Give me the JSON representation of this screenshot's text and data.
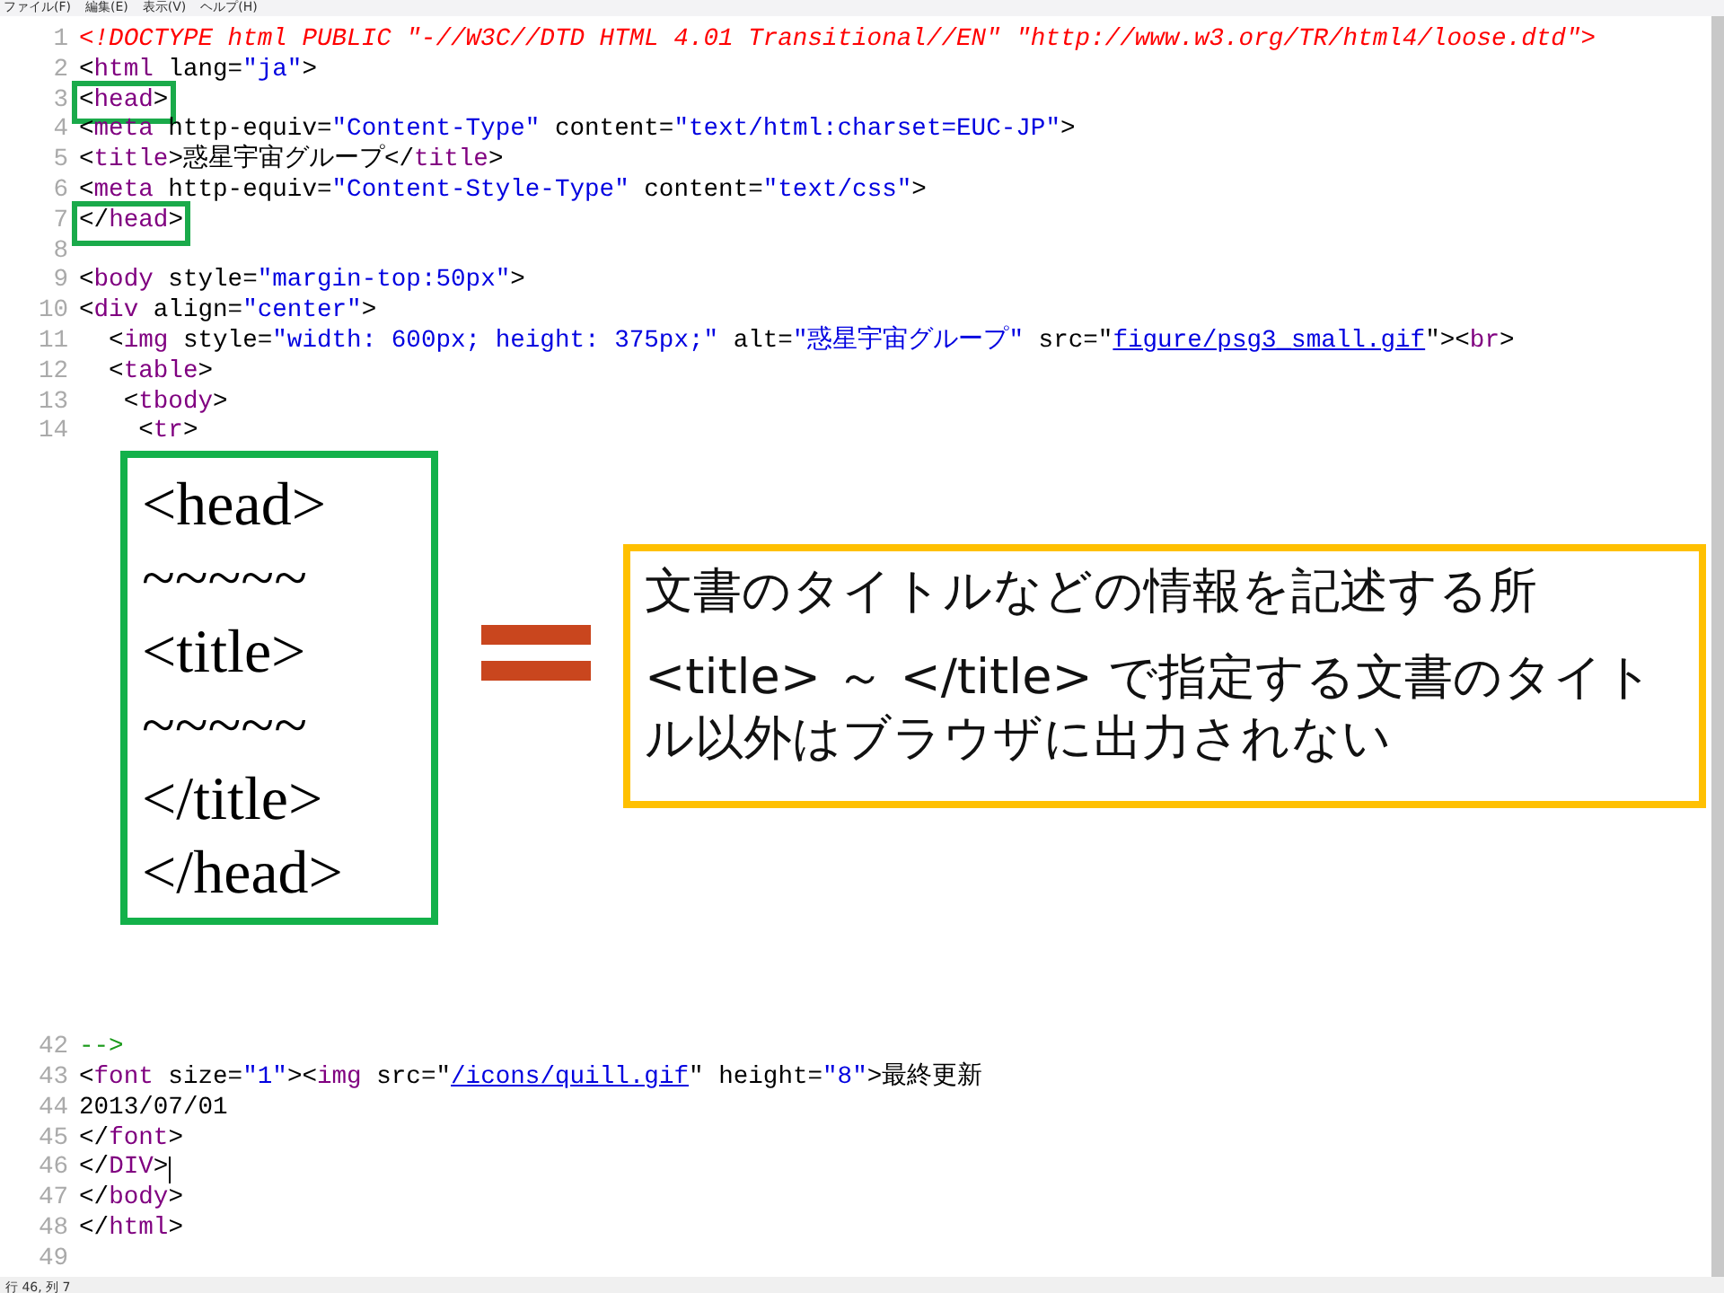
{
  "menu_bar": [
    "ファイル(F)",
    "編集(E)",
    "表示(V)",
    "ヘルプ(H)"
  ],
  "code_top": [
    {
      "number": "1",
      "highlight": false,
      "segments": [
        {
          "kind": "doctype",
          "text": "<!DOCTYPE html PUBLIC \"-//W3C//DTD HTML 4.01 Transitional//EN\" \"http://www.w3.org/TR/html4/loose.dtd\">"
        }
      ]
    },
    {
      "number": "2",
      "highlight": false,
      "segments": [
        {
          "kind": "punct",
          "text": "<"
        },
        {
          "kind": "tag",
          "text": "html"
        },
        {
          "kind": "attr",
          "text": " lang="
        },
        {
          "kind": "value",
          "text": "\"ja\""
        },
        {
          "kind": "punct",
          "text": ">"
        }
      ]
    },
    {
      "number": "3",
      "highlight": true,
      "segments": [
        {
          "kind": "punct",
          "text": "<"
        },
        {
          "kind": "tag",
          "text": "head"
        },
        {
          "kind": "punct",
          "text": ">"
        }
      ]
    },
    {
      "number": "4",
      "highlight": false,
      "segments": [
        {
          "kind": "punct",
          "text": "<"
        },
        {
          "kind": "tag",
          "text": "meta"
        },
        {
          "kind": "attr",
          "text": " http-equiv="
        },
        {
          "kind": "value",
          "text": "\"Content-Type\""
        },
        {
          "kind": "attr",
          "text": " content="
        },
        {
          "kind": "value",
          "text": "\"text/html:charset=EUC-JP\""
        },
        {
          "kind": "punct",
          "text": ">"
        }
      ]
    },
    {
      "number": "5",
      "highlight": false,
      "segments": [
        {
          "kind": "punct",
          "text": "<"
        },
        {
          "kind": "tag",
          "text": "title"
        },
        {
          "kind": "punct",
          "text": ">"
        },
        {
          "kind": "text",
          "text": "惑星宇宙グループ"
        },
        {
          "kind": "punct",
          "text": "</"
        },
        {
          "kind": "tag",
          "text": "title"
        },
        {
          "kind": "punct",
          "text": ">"
        }
      ]
    },
    {
      "number": "6",
      "highlight": false,
      "segments": [
        {
          "kind": "punct",
          "text": "<"
        },
        {
          "kind": "tag",
          "text": "meta"
        },
        {
          "kind": "attr",
          "text": " http-equiv="
        },
        {
          "kind": "value",
          "text": "\"Content-Style-Type\""
        },
        {
          "kind": "attr",
          "text": " content="
        },
        {
          "kind": "value",
          "text": "\"text/css\""
        },
        {
          "kind": "punct",
          "text": ">"
        }
      ]
    },
    {
      "number": "7",
      "highlight": true,
      "segments": [
        {
          "kind": "punct",
          "text": "</"
        },
        {
          "kind": "tag",
          "text": "head"
        },
        {
          "kind": "punct",
          "text": ">"
        }
      ]
    },
    {
      "number": "8",
      "highlight": false
    },
    {
      "number": "9",
      "highlight": false,
      "segments": [
        {
          "kind": "punct",
          "text": "<"
        },
        {
          "kind": "tag",
          "text": "body"
        },
        {
          "kind": "attr",
          "text": " style="
        },
        {
          "kind": "value",
          "text": "\"margin-top:50px\""
        },
        {
          "kind": "punct",
          "text": ">"
        }
      ]
    },
    {
      "number": "10",
      "highlight": false,
      "segments": [
        {
          "kind": "punct",
          "text": "<"
        },
        {
          "kind": "tag",
          "text": "div"
        },
        {
          "kind": "attr",
          "text": " align="
        },
        {
          "kind": "value",
          "text": "\"center\""
        },
        {
          "kind": "punct",
          "text": ">"
        }
      ]
    },
    {
      "number": "11",
      "highlight": false,
      "segments": [
        {
          "kind": "punct",
          "text": "  <"
        },
        {
          "kind": "tag",
          "text": "img"
        },
        {
          "kind": "attr",
          "text": " style="
        },
        {
          "kind": "value",
          "text": "\"width: 600px; height: 375px;\""
        },
        {
          "kind": "attr",
          "text": " alt="
        },
        {
          "kind": "value",
          "text": "\"惑星宇宙グループ\""
        },
        {
          "kind": "attr",
          "text": " src=\""
        },
        {
          "kind": "link",
          "text": "figure/psg3_small.gif"
        },
        {
          "kind": "punct",
          "text": "\"><"
        },
        {
          "kind": "tag",
          "text": "br"
        },
        {
          "kind": "punct",
          "text": ">"
        }
      ]
    },
    {
      "number": "12",
      "highlight": false,
      "segments": [
        {
          "kind": "punct",
          "text": "  <"
        },
        {
          "kind": "tag",
          "text": "table"
        },
        {
          "kind": "punct",
          "text": ">"
        }
      ]
    },
    {
      "number": "13",
      "highlight": false,
      "segments": [
        {
          "kind": "punct",
          "text": "   <"
        },
        {
          "kind": "tag",
          "text": "tbody"
        },
        {
          "kind": "punct",
          "text": ">"
        }
      ]
    },
    {
      "number": "14",
      "highlight": false,
      "segments": [
        {
          "kind": "punct",
          "text": "    <"
        },
        {
          "kind": "tag",
          "text": "tr"
        },
        {
          "kind": "punct",
          "text": ">"
        }
      ]
    }
  ],
  "annotation": {
    "code_lines": [
      "<head>",
      "~~~~~",
      "<title>",
      "~~~~~",
      "</title>",
      "</head>"
    ],
    "notes": [
      "文書のタイトルなどの情報を記述する所",
      "<title> ～ </title> で指定する文書のタイトル以外はブラウザに出力されない"
    ]
  },
  "code_bottom": [
    {
      "number": "42",
      "cursor": false,
      "segments": [
        {
          "kind": "comment",
          "text": "-->"
        }
      ]
    },
    {
      "number": "43",
      "cursor": false,
      "segments": [
        {
          "kind": "punct",
          "text": "<"
        },
        {
          "kind": "tag",
          "text": "font"
        },
        {
          "kind": "attr",
          "text": " size="
        },
        {
          "kind": "value",
          "text": "\"1\""
        },
        {
          "kind": "punct",
          "text": "><"
        },
        {
          "kind": "tag",
          "text": "img"
        },
        {
          "kind": "attr",
          "text": " src=\""
        },
        {
          "kind": "link",
          "text": "/icons/quill.gif"
        },
        {
          "kind": "attr",
          "text": "\" height="
        },
        {
          "kind": "value",
          "text": "\"8\""
        },
        {
          "kind": "punct",
          "text": ">"
        },
        {
          "kind": "text",
          "text": "最終更新"
        }
      ]
    },
    {
      "number": "44",
      "cursor": false,
      "segments": [
        {
          "kind": "text",
          "text": "2013/07/01"
        }
      ]
    },
    {
      "number": "45",
      "cursor": false,
      "segments": [
        {
          "kind": "punct",
          "text": "</"
        },
        {
          "kind": "tag",
          "text": "font"
        },
        {
          "kind": "punct",
          "text": ">"
        }
      ]
    },
    {
      "number": "46",
      "cursor": true,
      "segments": [
        {
          "kind": "punct",
          "text": "</"
        },
        {
          "kind": "tag",
          "text": "DIV"
        },
        {
          "kind": "punct",
          "text": ">"
        }
      ]
    },
    {
      "number": "47",
      "cursor": false,
      "segments": [
        {
          "kind": "punct",
          "text": "</"
        },
        {
          "kind": "tag",
          "text": "body"
        },
        {
          "kind": "punct",
          "text": ">"
        }
      ]
    },
    {
      "number": "48",
      "cursor": false,
      "segments": [
        {
          "kind": "punct",
          "text": "</"
        },
        {
          "kind": "tag",
          "text": "html"
        },
        {
          "kind": "punct",
          "text": ">"
        }
      ]
    },
    {
      "number": "49",
      "cursor": false
    }
  ],
  "status_bar": "行 46, 列 7"
}
